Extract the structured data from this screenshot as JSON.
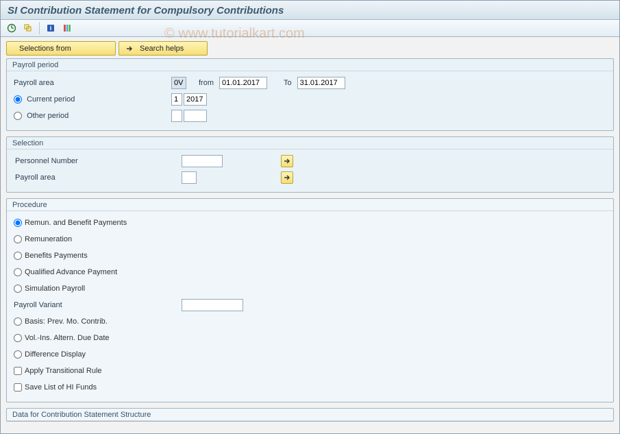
{
  "header": {
    "title": "SI Contribution Statement for Compulsory Contributions"
  },
  "actions": {
    "selections_from_label": "Selections from",
    "search_helps_label": "Search helps"
  },
  "payroll_period": {
    "group_title": "Payroll period",
    "area_label": "Payroll area",
    "area_value": "0V",
    "from_label": "from",
    "from_value": "01.01.2017",
    "to_label": "To",
    "to_value": "31.01.2017",
    "current_label": "Current period",
    "current_n": "1",
    "current_year": "2017",
    "other_label": "Other period"
  },
  "selection": {
    "group_title": "Selection",
    "personnel_label": "Personnel Number",
    "personnel_value": "",
    "payroll_area_label": "Payroll area",
    "payroll_area_value": ""
  },
  "procedure": {
    "group_title": "Procedure",
    "opt_rb": "Remun. and Benefit Payments",
    "opt_rem": "Remuneration",
    "opt_ben": "Benefits Payments",
    "opt_qap": "Qualified Advance Payment",
    "opt_sim": "Simulation Payroll",
    "variant_label": "Payroll Variant",
    "variant_value": "",
    "opt_basis": "Basis: Prev. Mo. Contrib.",
    "opt_vol": "Vol.-Ins. Altern. Due Date",
    "opt_diff": "Difference Display",
    "chk_rule": "Apply Transitional Rule",
    "chk_save": "Save List of HI Funds"
  },
  "bottom": {
    "group_title": "Data for Contribution Statement Structure"
  },
  "watermark": "© www.tutorialkart.com"
}
